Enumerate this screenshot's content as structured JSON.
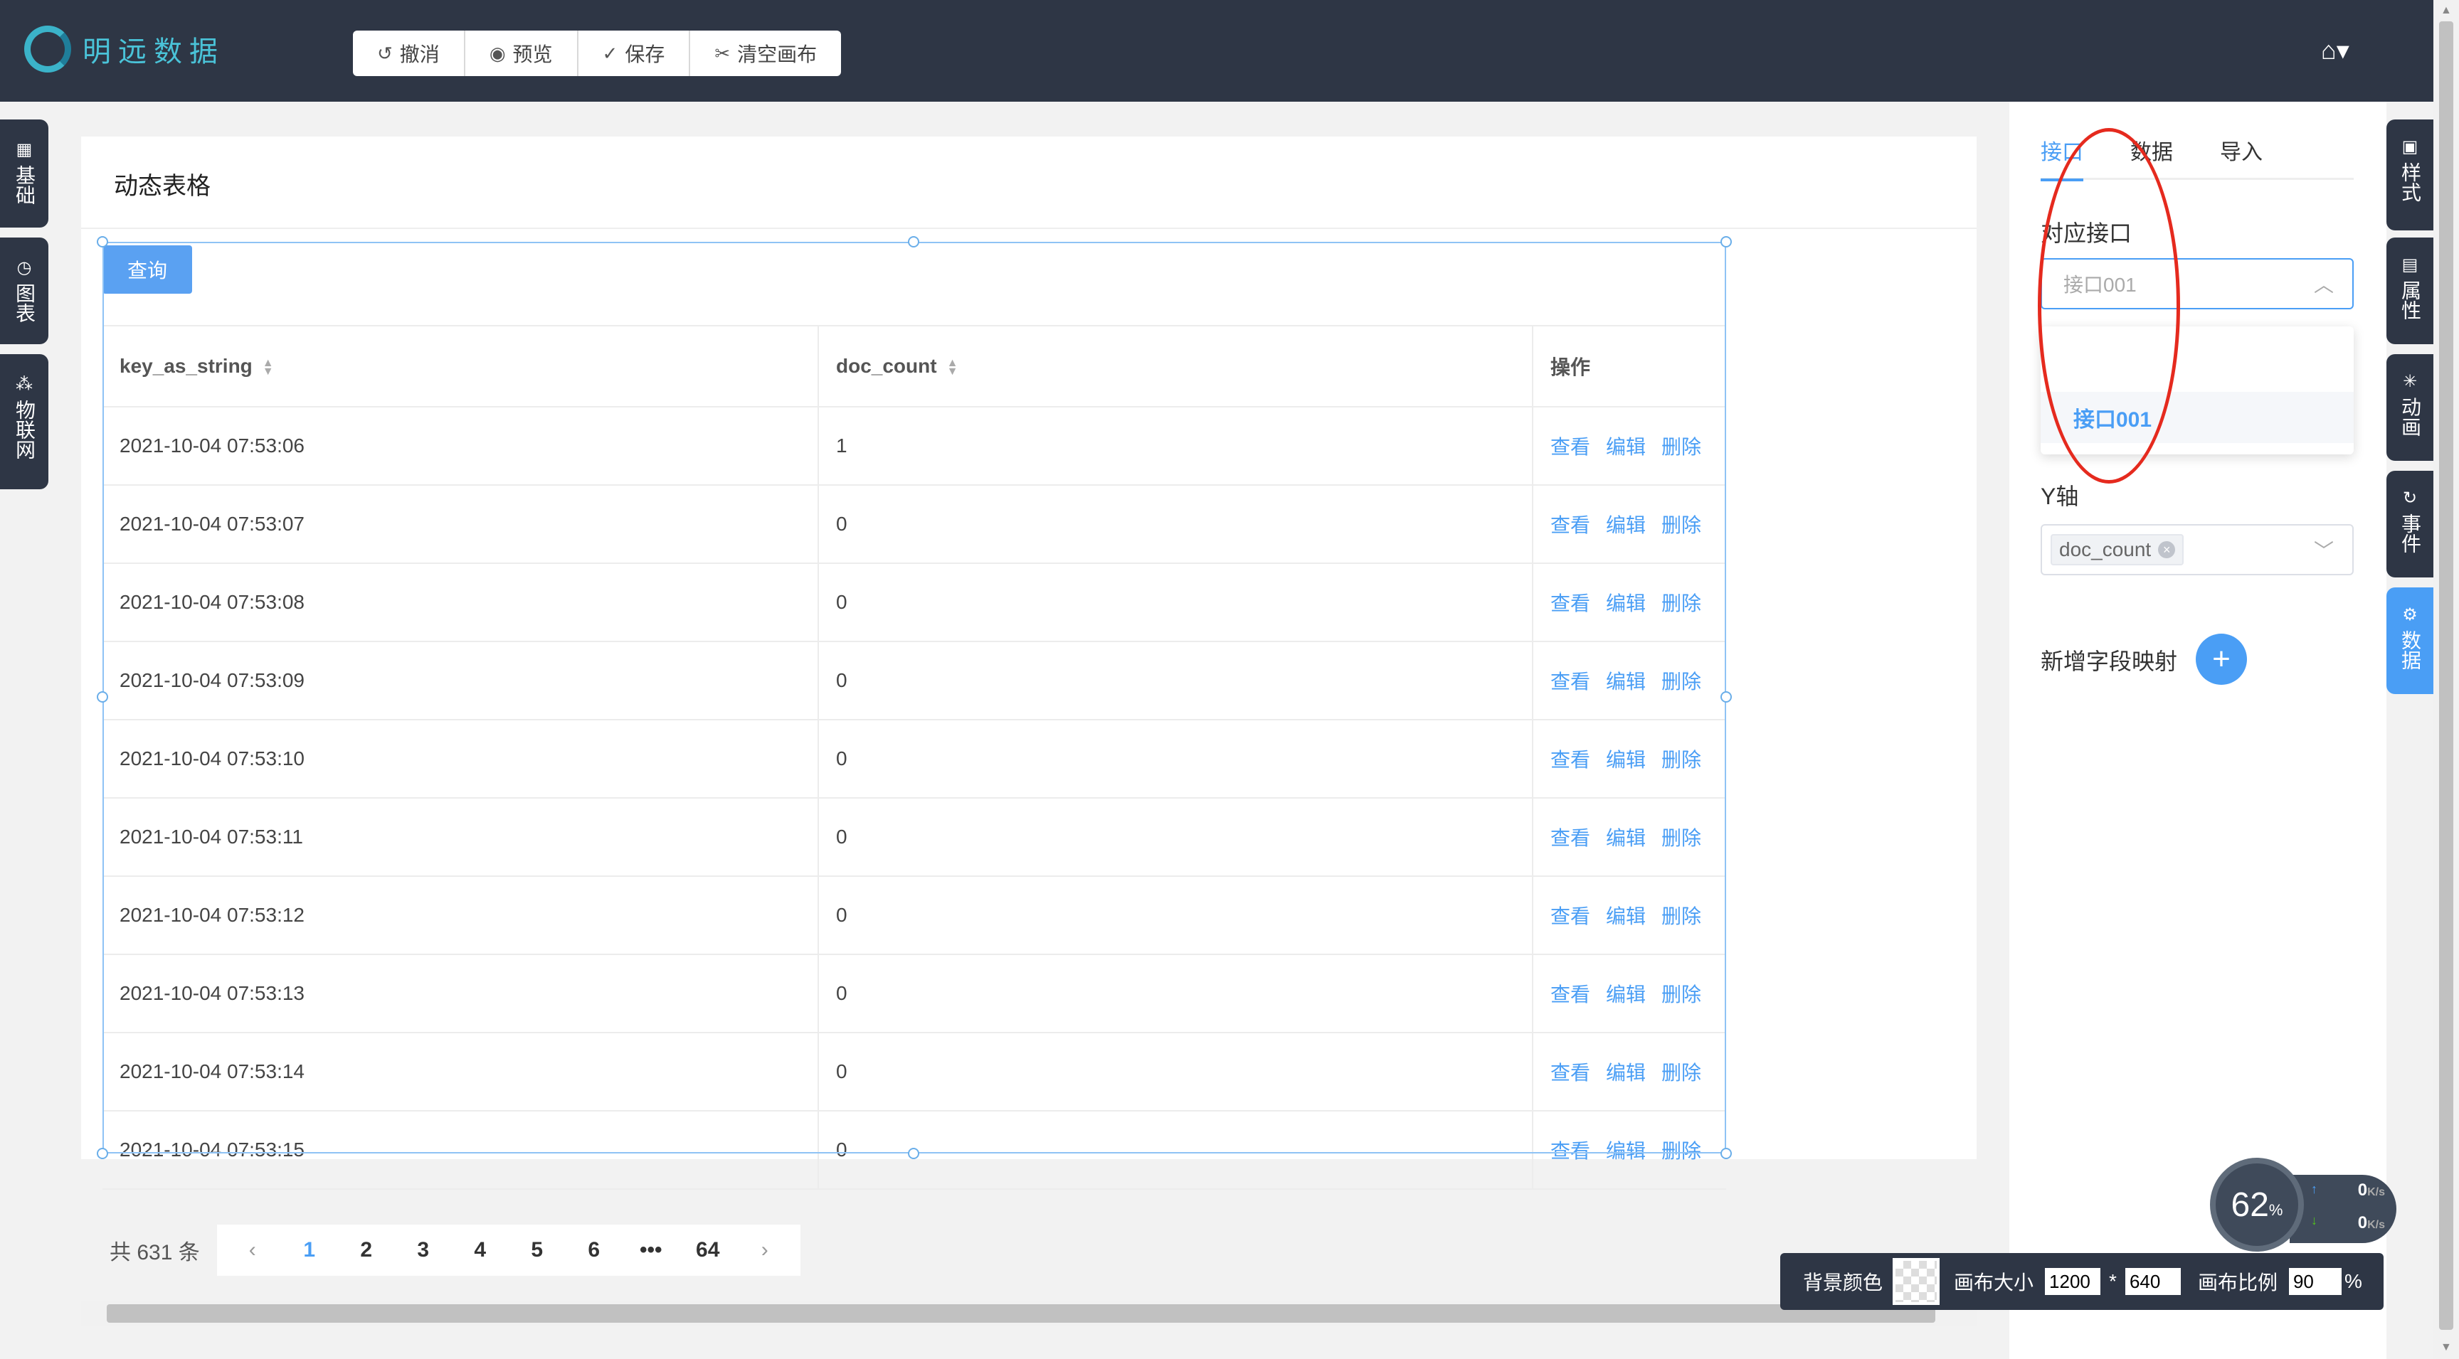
{
  "header": {
    "logo_text": "明远数据",
    "toolbar": {
      "undo": "撤消",
      "preview": "预览",
      "save": "保存",
      "clear": "清空画布"
    },
    "home_icon": "home-icon"
  },
  "left_dock": [
    {
      "label": "基础",
      "icon": "grid-icon"
    },
    {
      "label": "图表",
      "icon": "pie-chart-icon"
    },
    {
      "label": "物联网",
      "icon": "network-icon"
    }
  ],
  "right_dock": [
    {
      "label": "样式",
      "icon": "picture-icon"
    },
    {
      "label": "属性",
      "icon": "doc-icon"
    },
    {
      "label": "动画",
      "icon": "spark-icon"
    },
    {
      "label": "事件",
      "icon": "refresh-icon"
    },
    {
      "label": "数据",
      "icon": "gear-icon"
    }
  ],
  "canvas": {
    "title": "动态表格",
    "query_button": "查询",
    "columns": [
      "key_as_string",
      "doc_count",
      "操作"
    ],
    "actions": [
      "查看",
      "编辑",
      "删除"
    ],
    "rows": [
      [
        "2021-10-04 07:53:06",
        "1"
      ],
      [
        "2021-10-04 07:53:07",
        "0"
      ],
      [
        "2021-10-04 07:53:08",
        "0"
      ],
      [
        "2021-10-04 07:53:09",
        "0"
      ],
      [
        "2021-10-04 07:53:10",
        "0"
      ],
      [
        "2021-10-04 07:53:11",
        "0"
      ],
      [
        "2021-10-04 07:53:12",
        "0"
      ],
      [
        "2021-10-04 07:53:13",
        "0"
      ],
      [
        "2021-10-04 07:53:14",
        "0"
      ],
      [
        "2021-10-04 07:53:15",
        "0"
      ]
    ]
  },
  "pagination": {
    "total": "共 631 条",
    "pages": [
      "1",
      "2",
      "3",
      "4",
      "5",
      "6",
      "•••",
      "64"
    ],
    "current": "1"
  },
  "right_panel": {
    "tabs": [
      "接口",
      "数据",
      "导入"
    ],
    "active_tab": "接口",
    "interface_label": "对应接口",
    "interface_value": "接口001",
    "dropdown_option": "接口001",
    "y_axis_label": "Y轴",
    "y_axis_tag": "doc_count",
    "add_mapping_label": "新增字段映射"
  },
  "speed_widget": {
    "percent": "62",
    "percent_unit": "%",
    "up": "0",
    "down": "0",
    "unit": "K/s"
  },
  "canvas_settings": {
    "bg_color_label": "背景颜色",
    "size_label": "画布大小",
    "width": "1200",
    "times": "*",
    "height": "640",
    "ratio_label": "画布比例",
    "ratio": "90",
    "percent": "%"
  }
}
